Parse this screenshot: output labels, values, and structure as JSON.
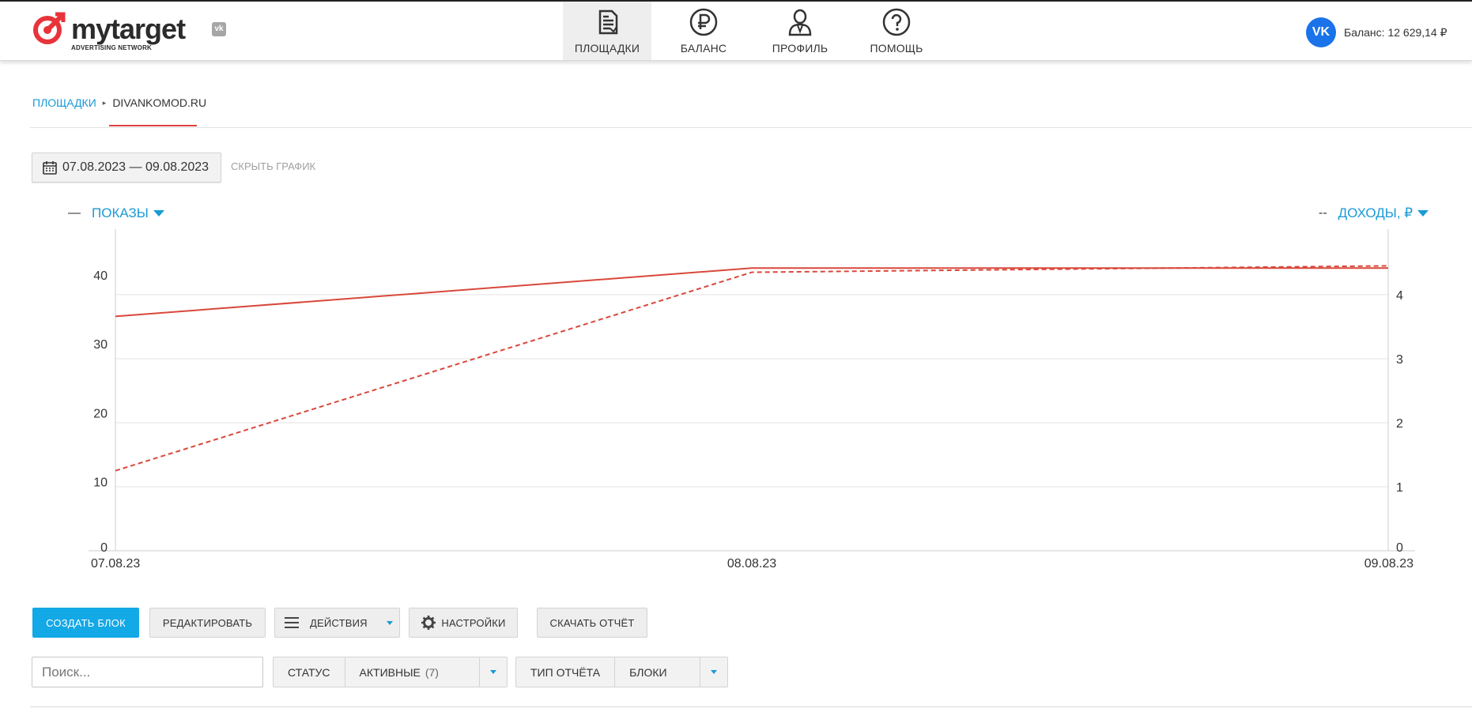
{
  "app": {
    "logo_text": "mytarget",
    "logo_sub": "ADVERTISING NETWORK",
    "vk_badge": "vk"
  },
  "nav": [
    {
      "label": "ПЛОЩАДКИ",
      "icon": "document-icon",
      "active": true
    },
    {
      "label": "БАЛАНС",
      "icon": "ruble-icon",
      "active": false
    },
    {
      "label": "ПРОФИЛЬ",
      "icon": "user-icon",
      "active": false
    },
    {
      "label": "ПОМОЩЬ",
      "icon": "question-icon",
      "active": false
    }
  ],
  "account": {
    "avatar": "VK",
    "balance": "Баланс: 12 629,14 ₽"
  },
  "breadcrumbs": {
    "root": "ПЛОЩАДКИ",
    "current": "DIVANKOMOD.RU"
  },
  "date_range": "07.08.2023 — 09.08.2023",
  "hide_chart": "СКРЫТЬ ГРАФИК",
  "legend": {
    "left_mark": "—",
    "left_label": "ПОКАЗЫ",
    "right_mark": "--",
    "right_label": "ДОХОДЫ, ₽"
  },
  "chart_data": {
    "type": "line",
    "x": [
      "07.08.23",
      "08.08.23",
      "09.08.23"
    ],
    "y_left": {
      "ticks": [
        0,
        10,
        20,
        30,
        40
      ],
      "max": 45.5
    },
    "y_right": {
      "ticks": [
        0,
        1,
        2,
        3,
        4
      ],
      "max": 4.9
    },
    "grid": true,
    "line_color": "#d9483b",
    "series": [
      {
        "name": "ПОКАЗЫ",
        "axis": "left",
        "style": "solid",
        "values": [
          34,
          41,
          41
        ]
      },
      {
        "name": "ДОХОДЫ, ₽",
        "axis": "right",
        "style": "dashed",
        "values": [
          1.25,
          4.35,
          4.45
        ]
      }
    ]
  },
  "toolbar": {
    "create": "СОЗДАТЬ БЛОК",
    "edit": "РЕДАКТИРОВАТЬ",
    "actions": "ДЕЙСТВИЯ",
    "settings": "НАСТРОЙКИ",
    "download": "СКАЧАТЬ ОТЧЁТ"
  },
  "search": {
    "placeholder": "Поиск..."
  },
  "filters": {
    "status_label": "СТАТУС",
    "status_value": "АКТИВНЫЕ",
    "status_count": "(7)",
    "report_label": "ТИП ОТЧЁТА",
    "report_value": "БЛОКИ"
  },
  "colors": {
    "accent": "#13a8e6",
    "link": "#1a9ad6",
    "line": "#d9483b"
  }
}
